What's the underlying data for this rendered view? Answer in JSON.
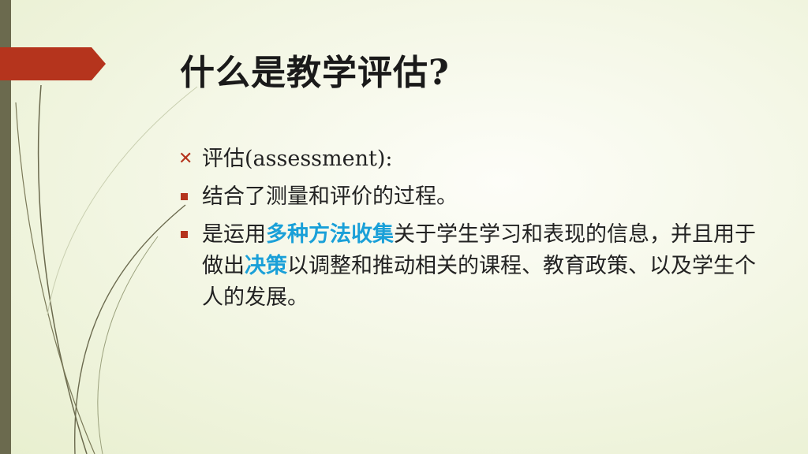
{
  "title": "什么是教学评估?",
  "bullets": [
    {
      "icon": "x-marker-icon",
      "text": "评估(assessment):"
    },
    {
      "icon": "square-bullet-icon",
      "text": "结合了测量和评价的过程。"
    },
    {
      "icon": "square-bullet-icon",
      "parts": [
        {
          "text": "是运用"
        },
        {
          "text": "多种方法收集",
          "highlight": true
        },
        {
          "text": "关于学生学习和表现的信息，并且用于做出"
        },
        {
          "text": "决策",
          "highlight": true
        },
        {
          "text": "以调整和推动相关的课程、教育政策、以及学生个人的发展。"
        }
      ]
    }
  ],
  "colors": {
    "accent": "#b5341d",
    "highlight": "#1aa0d8",
    "sidebar": "#6b6a4e"
  }
}
